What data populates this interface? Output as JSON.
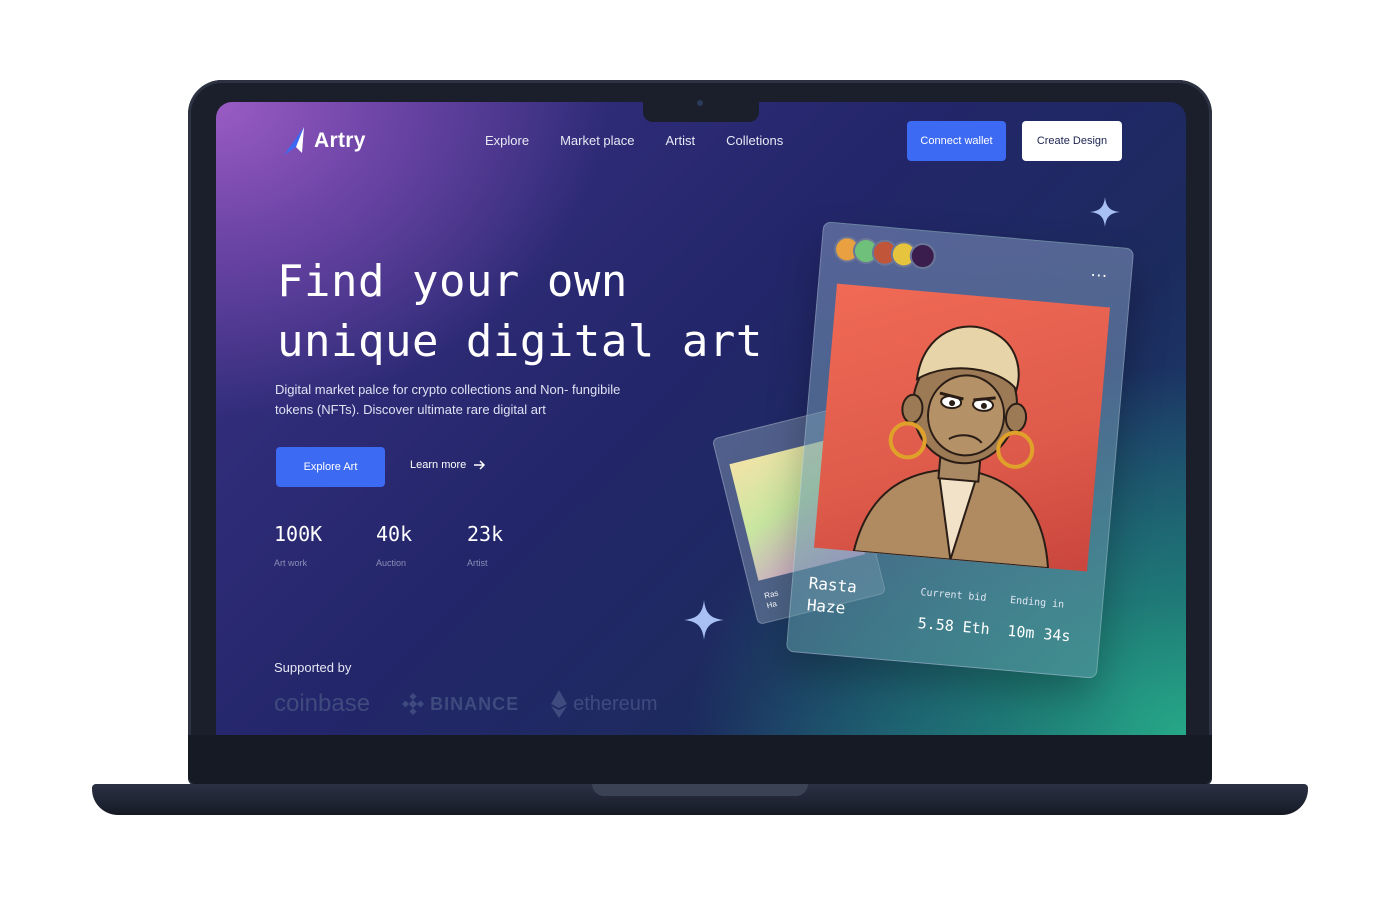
{
  "brand": {
    "name": "Artry"
  },
  "nav": {
    "items": [
      "Explore",
      "Market place",
      "Artist",
      "Colletions"
    ]
  },
  "actions": {
    "connect_wallet": "Connect wallet",
    "create_design": "Create Design"
  },
  "hero": {
    "title_line1": "Find your own",
    "title_line2": "unique digital art",
    "subtitle": "Digital market palce for crypto collections and Non- fungibile tokens (NFTs). Discover ultimate rare digital art",
    "primary_cta": "Explore Art",
    "secondary_cta": "Learn more"
  },
  "stats": [
    {
      "value": "100K",
      "label": "Art work"
    },
    {
      "value": "40k",
      "label": "Auction"
    },
    {
      "value": "23k",
      "label": "Artist"
    }
  ],
  "supported": {
    "label": "Supported by",
    "partners": [
      "coinbase",
      "BINANCE",
      "ethereum"
    ]
  },
  "nft_card": {
    "name_line1": "Rasta",
    "name_line2": "Haze",
    "current_bid_label": "Current bid",
    "current_bid_value": "5.58 Eth",
    "ending_label": "Ending in",
    "ending_value": "10m 34s",
    "more_icon": "…"
  },
  "back_card": {
    "name_line1": "Ras",
    "name_line2": "Ha"
  },
  "colors": {
    "accent": "#3d6af2",
    "gradient_purple": "#9a5cc4",
    "gradient_navy": "#23266a",
    "gradient_teal": "#26a887"
  }
}
